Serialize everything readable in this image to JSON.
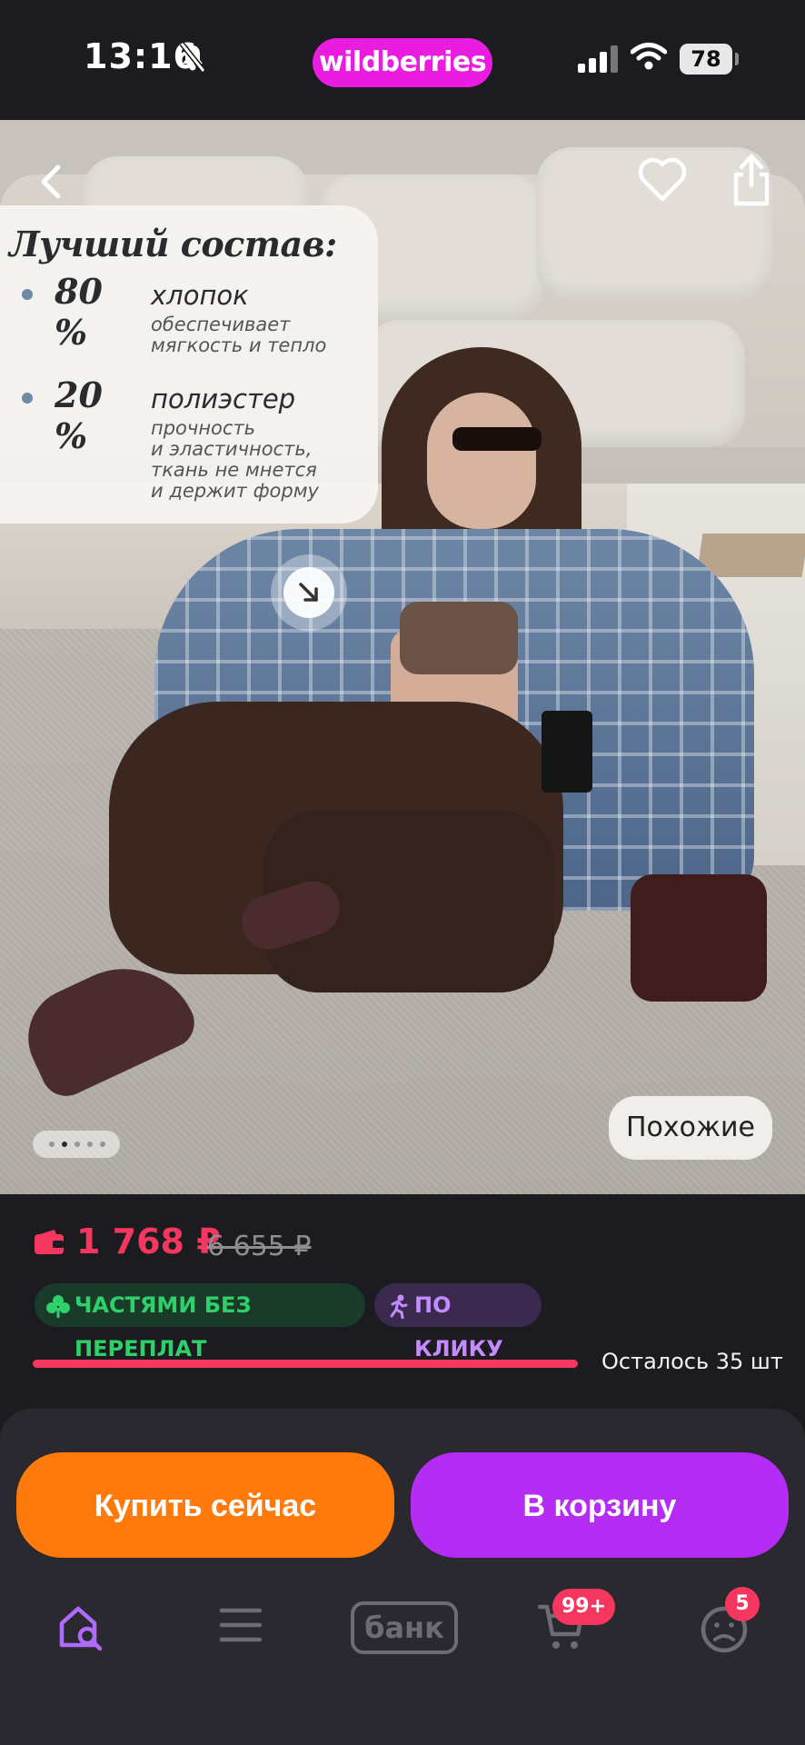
{
  "status_bar": {
    "time": "13:16",
    "battery": "78",
    "brand": "wildberries"
  },
  "product_image": {
    "overlay": {
      "title": "Лучший состав:",
      "items": [
        {
          "percent": "80 %",
          "material": "хлопок",
          "description": [
            "обеспечивает",
            "мягкость и тепло"
          ]
        },
        {
          "percent": "20 %",
          "material": "полиэстер",
          "description": [
            "прочность",
            "и эластичность,",
            "ткань не мнется",
            "и держит форму"
          ]
        }
      ]
    },
    "similar_label": "Похожие",
    "carousel": {
      "count": 5,
      "active_index": 1
    }
  },
  "price": {
    "current": "1 768 ₽",
    "old": "6 655 ₽",
    "currency_icon": "wallet-icon"
  },
  "badges": [
    {
      "label": "ЧАСТЯМИ БЕЗ ПЕРЕПЛАТ",
      "color": "#2ed06a",
      "icon": "clover-icon"
    },
    {
      "label": "ПО КЛИКУ",
      "color": "#c58aff",
      "icon": "running-person-icon"
    }
  ],
  "stock": {
    "label": "Осталось 35 шт"
  },
  "actions": {
    "buy_now": "Купить сейчас",
    "add_to_cart": "В корзину"
  },
  "bottom_nav": {
    "items": [
      {
        "name": "home-search",
        "icon": "home-search-icon"
      },
      {
        "name": "catalog",
        "icon": "menu-icon"
      },
      {
        "name": "bank",
        "label": "банк"
      },
      {
        "name": "cart",
        "icon": "cart-icon",
        "badge": "99+"
      },
      {
        "name": "profile",
        "icon": "profile-icon",
        "badge": "5"
      }
    ]
  },
  "colors": {
    "accent_pink": "#f5375f",
    "brand_magenta": "#e91ce0",
    "buy_orange": "#ff7a0a",
    "cart_purple": "#b52cf5",
    "nav_active": "#b06aff"
  }
}
